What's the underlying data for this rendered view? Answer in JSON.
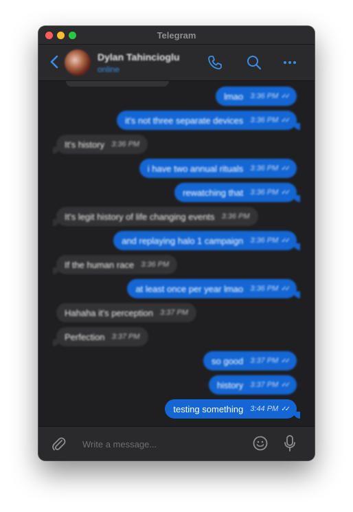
{
  "window": {
    "title": "Telegram"
  },
  "header": {
    "contact_name": "Dylan Tahincioglu",
    "status": "online",
    "icons": [
      "back-icon",
      "phone-icon",
      "search-icon",
      "more-icon"
    ]
  },
  "messages": [
    {
      "text": "lmao",
      "time": "3:36 PM",
      "direction": "out"
    },
    {
      "text": "it's not three separate devices",
      "time": "3:36 PM",
      "direction": "out"
    },
    {
      "text": "It's history",
      "time": "3:36 PM",
      "direction": "in"
    },
    {
      "text": "i have two annual rituals",
      "time": "3:36 PM",
      "direction": "out"
    },
    {
      "text": "rewatching that",
      "time": "3:36 PM",
      "direction": "out"
    },
    {
      "text": "It's legit history of life changing events",
      "time": "3:36 PM",
      "direction": "in"
    },
    {
      "text": "and replaying halo 1 campaign",
      "time": "3:36 PM",
      "direction": "out"
    },
    {
      "text": "If the human race",
      "time": "3:36 PM",
      "direction": "in"
    },
    {
      "text": "at least once per year lmao",
      "time": "3:36 PM",
      "direction": "out"
    },
    {
      "text": "Hahaha it's perception",
      "time": "3:37 PM",
      "direction": "in"
    },
    {
      "text": "Perfection",
      "time": "3:37 PM",
      "direction": "in"
    },
    {
      "text": "so good",
      "time": "3:37 PM",
      "direction": "out"
    },
    {
      "text": "history",
      "time": "3:37 PM",
      "direction": "out"
    },
    {
      "text": "testing something",
      "time": "3:44 PM",
      "direction": "out"
    }
  ],
  "composer": {
    "placeholder": "Write a message...",
    "icons": [
      "attach-icon",
      "emoji-icon",
      "microphone-icon"
    ]
  },
  "colors": {
    "outgoing_bubble": "#1466d4",
    "incoming_bubble": "#333335",
    "accent": "#3a8ee6",
    "background": "#1f1f21"
  }
}
